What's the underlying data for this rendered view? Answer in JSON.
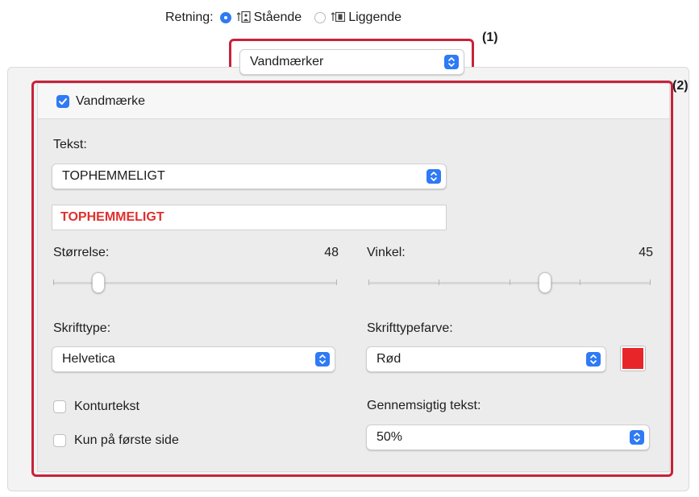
{
  "orientation": {
    "label": "Retning:",
    "options": [
      {
        "label": "Stående",
        "selected": true
      },
      {
        "label": "Liggende",
        "selected": false
      }
    ]
  },
  "callouts": {
    "one": "(1)",
    "two": "(2)"
  },
  "panel_select": {
    "value": "Vandmærker"
  },
  "watermark": {
    "checkbox_label": "Vandmærke",
    "checked": true,
    "text_label": "Tekst:",
    "text_preset": "TOPHEMMELIGT",
    "text_value": "TOPHEMMELIGT",
    "text_color": "#e0302e",
    "size": {
      "label": "Størrelse:",
      "value": "48",
      "fraction": 0.16
    },
    "angle": {
      "label": "Vinkel:",
      "value": "45",
      "fraction": 0.625
    },
    "font": {
      "label": "Skrifttype:",
      "value": "Helvetica"
    },
    "font_color": {
      "label": "Skrifttypefarve:",
      "value": "Rød",
      "swatch": "#e8262a"
    },
    "outline": {
      "label": "Konturtekst",
      "checked": false
    },
    "first_page_only": {
      "label": "Kun på første side",
      "checked": false
    },
    "transparency": {
      "label": "Gennemsigtig tekst:",
      "value": "50%"
    }
  },
  "colors": {
    "accent": "#2f7af5",
    "callout_frame": "#c8223a"
  }
}
